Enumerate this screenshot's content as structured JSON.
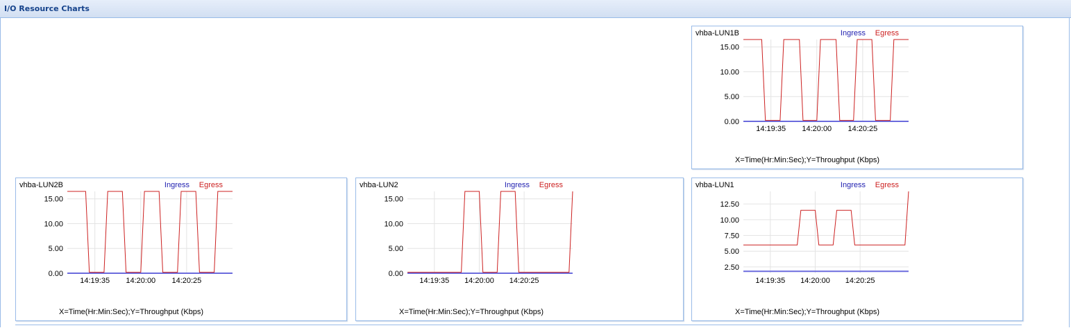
{
  "panel": {
    "title": "I/O Resource Charts"
  },
  "colors": {
    "ingress": "#2020b0",
    "egress": "#cc2020",
    "ingress_line": "#6b6bdd"
  },
  "legend": {
    "ingress": "Ingress",
    "egress": "Egress"
  },
  "chart_data": [
    {
      "type": "line",
      "title": "vhba-LUN1B",
      "xlabel": "X=Time(Hr:Min:Sec);Y=Throughput (Kbps)",
      "ylabel": "",
      "x_tick_labels": [
        "14:19:35",
        "14:20:00",
        "14:20:25"
      ],
      "x_tick_positions": [
        3,
        8,
        13
      ],
      "yticks": [
        0,
        5,
        10,
        15
      ],
      "ytick_labels": [
        "0.00",
        "5.00",
        "10.00",
        "15.00"
      ],
      "ylim": [
        0,
        16.5
      ],
      "xlim": [
        0,
        18
      ],
      "grid": true,
      "legend_position": "top-right",
      "series": [
        {
          "name": "Ingress",
          "x": [
            0,
            18
          ],
          "y": [
            0,
            0
          ]
        },
        {
          "name": "Egress",
          "x": [
            0,
            2.0,
            2.4,
            4.0,
            4.4,
            6.1,
            6.5,
            8.0,
            8.4,
            10.1,
            10.5,
            12.0,
            12.4,
            14.0,
            14.4,
            16.0,
            16.4,
            18
          ],
          "y": [
            16.5,
            16.5,
            0.2,
            0.2,
            16.5,
            16.5,
            0.2,
            0.2,
            16.5,
            16.5,
            0.2,
            0.2,
            16.5,
            16.5,
            0.2,
            0.2,
            16.5,
            16.5
          ]
        }
      ]
    },
    {
      "type": "line",
      "title": "vhba-LUN2B",
      "xlabel": "X=Time(Hr:Min:Sec);Y=Throughput (Kbps)",
      "ylabel": "",
      "x_tick_labels": [
        "14:19:35",
        "14:20:00",
        "14:20:25"
      ],
      "x_tick_positions": [
        3,
        8,
        13
      ],
      "yticks": [
        0,
        5,
        10,
        15
      ],
      "ytick_labels": [
        "0.00",
        "5.00",
        "10.00",
        "15.00"
      ],
      "ylim": [
        0,
        16.5
      ],
      "xlim": [
        0,
        18
      ],
      "grid": true,
      "legend_position": "top-right",
      "series": [
        {
          "name": "Ingress",
          "x": [
            0,
            18
          ],
          "y": [
            0,
            0
          ]
        },
        {
          "name": "Egress",
          "x": [
            0,
            2.0,
            2.4,
            4.0,
            4.4,
            6.0,
            6.4,
            8.0,
            8.4,
            10.0,
            10.4,
            12.0,
            12.4,
            14.0,
            14.4,
            16.0,
            16.4,
            18
          ],
          "y": [
            16.5,
            16.5,
            0.2,
            0.2,
            16.5,
            16.5,
            0.2,
            0.2,
            16.5,
            16.5,
            0.2,
            0.2,
            16.5,
            16.5,
            0.2,
            0.2,
            16.5,
            16.5
          ]
        }
      ]
    },
    {
      "type": "line",
      "title": "vhba-LUN2",
      "xlabel": "X=Time(Hr:Min:Sec);Y=Throughput (Kbps)",
      "ylabel": "",
      "x_tick_labels": [
        "14:19:35",
        "14:20:00",
        "14:20:25"
      ],
      "x_tick_positions": [
        3,
        8,
        13
      ],
      "yticks": [
        0,
        5,
        10,
        15
      ],
      "ytick_labels": [
        "0.00",
        "5.00",
        "10.00",
        "15.00"
      ],
      "ylim": [
        0,
        16.5
      ],
      "xlim": [
        0,
        18.4
      ],
      "grid": true,
      "legend_position": "top-right",
      "series": [
        {
          "name": "Ingress",
          "x": [
            0,
            18.4
          ],
          "y": [
            0,
            0
          ]
        },
        {
          "name": "Egress",
          "x": [
            0,
            6.0,
            6.4,
            8.0,
            8.4,
            10.0,
            10.4,
            12.0,
            12.4,
            18.0,
            18.4
          ],
          "y": [
            0.2,
            0.2,
            16.5,
            16.5,
            0.2,
            0.2,
            16.5,
            16.5,
            0.2,
            0.2,
            16.5
          ]
        }
      ]
    },
    {
      "type": "line",
      "title": "vhba-LUN1",
      "xlabel": "X=Time(Hr:Min:Sec);Y=Throughput (Kbps)",
      "ylabel": "",
      "x_tick_labels": [
        "14:19:35",
        "14:20:00",
        "14:20:25"
      ],
      "x_tick_positions": [
        3,
        8,
        13
      ],
      "yticks": [
        2.5,
        5,
        7.5,
        10,
        12.5
      ],
      "ytick_labels": [
        "2.50",
        "5.00",
        "7.50",
        "10.00",
        "12.50"
      ],
      "ylim": [
        1.5,
        14.5
      ],
      "xlim": [
        0,
        18.4
      ],
      "grid": true,
      "legend_position": "top-right",
      "series": [
        {
          "name": "Ingress",
          "x": [
            0,
            18.4
          ],
          "y": [
            1.8,
            1.8
          ]
        },
        {
          "name": "Egress",
          "x": [
            0,
            6.0,
            6.4,
            8.0,
            8.4,
            10.0,
            10.4,
            12.0,
            12.4,
            18.0,
            18.4
          ],
          "y": [
            6.0,
            6.0,
            11.5,
            11.5,
            6.0,
            6.0,
            11.5,
            11.5,
            6.0,
            6.0,
            14.5
          ]
        }
      ]
    }
  ]
}
